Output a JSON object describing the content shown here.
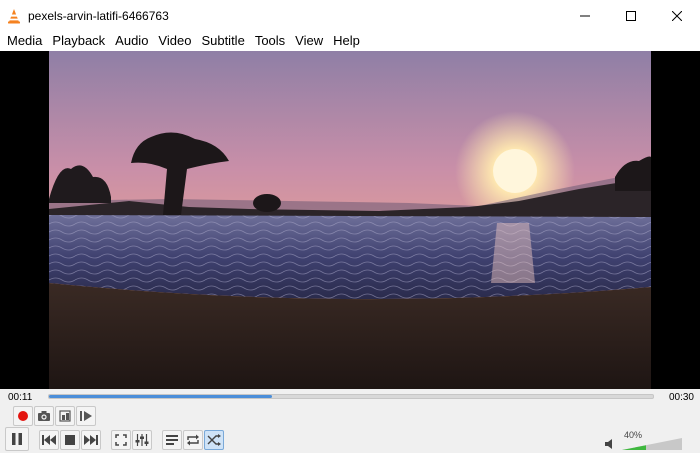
{
  "window": {
    "title": "pexels-arvin-latifi-6466763",
    "app_icon": "vlc-cone-icon",
    "controls": [
      "minimize-icon",
      "maximize-icon",
      "close-icon"
    ]
  },
  "menu": {
    "items": [
      "Media",
      "Playback",
      "Audio",
      "Video",
      "Subtitle",
      "Tools",
      "View",
      "Help"
    ]
  },
  "player": {
    "elapsed": "00:11",
    "total": "00:30",
    "progress_fraction": 0.37,
    "volume_percent": "40%",
    "volume_fraction": 0.4,
    "accent_color": "#4b8ed9",
    "record_color": "#e3140f",
    "advanced_buttons": [
      "record-icon",
      "snapshot-icon",
      "loop-ab-icon",
      "frame-step-icon"
    ],
    "main_buttons": [
      "pause-icon",
      "previous-icon",
      "stop-icon",
      "next-icon",
      "fullscreen-icon",
      "extended-settings-icon",
      "playlist-icon",
      "loop-icon",
      "shuffle-icon"
    ],
    "shuffle_active": true
  }
}
